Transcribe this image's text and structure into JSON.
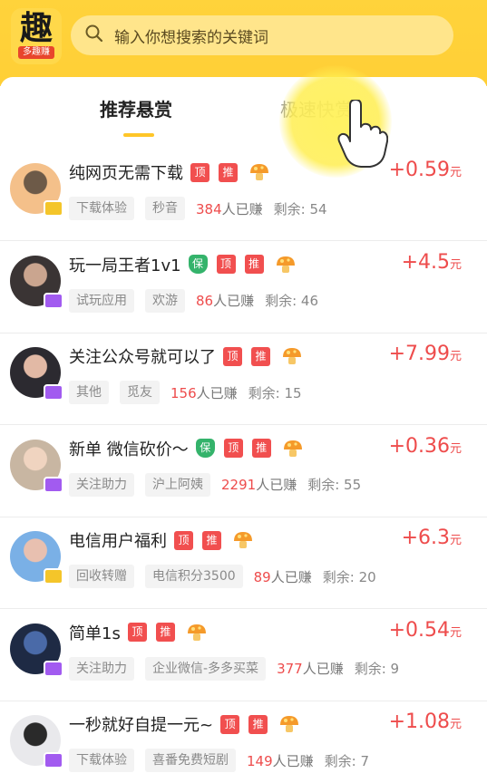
{
  "header": {
    "logo_char": "趣",
    "logo_sub": "多趣赚",
    "search_placeholder": "输入你想搜索的关键词"
  },
  "tabs": [
    {
      "label": "推荐悬赏",
      "active": true
    },
    {
      "label": "极速快赏",
      "active": false
    }
  ],
  "colors": {
    "accent": "#ffcf36",
    "reward": "#ee4c4c",
    "tag_red": "#f14f4f",
    "tag_green": "#34b36b"
  },
  "tasks": [
    {
      "title": "纯网页无需下载",
      "safe": false,
      "tag_top": "顶",
      "tag_rec": "推",
      "category": "下载体验",
      "publisher": "秒音",
      "earned_count": "384",
      "earned_suffix": "人已赚",
      "remain": "剩余: 54",
      "reward": "+0.59",
      "unit": "元",
      "avatar_badge": "gold"
    },
    {
      "title": "玩一局王者1v1",
      "safe": true,
      "tag_safe": "保",
      "tag_top": "顶",
      "tag_rec": "推",
      "category": "试玩应用",
      "publisher": "欢游",
      "earned_count": "86",
      "earned_suffix": "人已赚",
      "remain": "剩余: 46",
      "reward": "+4.5",
      "unit": "元",
      "avatar_badge": "purple"
    },
    {
      "title": "关注公众号就可以了",
      "safe": false,
      "tag_top": "顶",
      "tag_rec": "推",
      "category": "其他",
      "publisher": "觅友",
      "earned_count": "156",
      "earned_suffix": "人已赚",
      "remain": "剩余: 15",
      "reward": "+7.99",
      "unit": "元",
      "avatar_badge": "purple"
    },
    {
      "title": "新单  微信砍价～",
      "safe": true,
      "tag_safe": "保",
      "tag_top": "顶",
      "tag_rec": "推",
      "category": "关注助力",
      "publisher": "沪上阿姨",
      "earned_count": "2291",
      "earned_suffix": "人已赚",
      "remain": "剩余: 55",
      "reward": "+0.36",
      "unit": "元",
      "avatar_badge": "purple"
    },
    {
      "title": "电信用户福利",
      "safe": false,
      "tag_top": "顶",
      "tag_rec": "推",
      "category": "回收转赠",
      "publisher": "电信积分3500",
      "earned_count": "89",
      "earned_suffix": "人已赚",
      "remain": "剩余: 20",
      "reward": "+6.3",
      "unit": "元",
      "avatar_badge": "gold"
    },
    {
      "title": "简单1s",
      "safe": false,
      "tag_top": "顶",
      "tag_rec": "推",
      "category": "关注助力",
      "publisher": "企业微信-多多买菜",
      "earned_count": "377",
      "earned_suffix": "人已赚",
      "remain": "剩余: 9",
      "reward": "+0.54",
      "unit": "元",
      "avatar_badge": "purple"
    },
    {
      "title": "一秒就好自提一元~",
      "safe": false,
      "tag_top": "顶",
      "tag_rec": "推",
      "category": "下载体验",
      "publisher": "喜番免费短剧",
      "earned_count": "149",
      "earned_suffix": "人已赚",
      "remain": "剩余: 7",
      "reward": "+1.08",
      "unit": "元",
      "avatar_badge": "purple"
    }
  ]
}
